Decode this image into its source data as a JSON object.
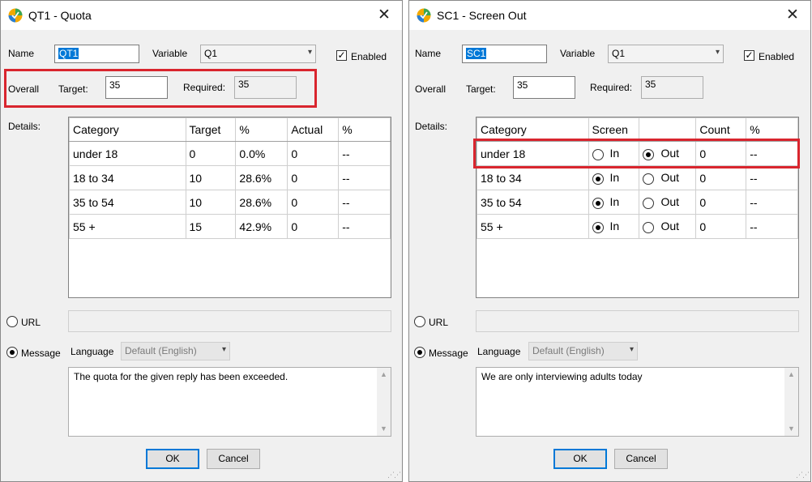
{
  "quota_dialog": {
    "title": "QT1 - Quota",
    "name_label": "Name",
    "name_value": "QT1",
    "variable_label": "Variable",
    "variable_value": "Q1",
    "enabled_label": "Enabled",
    "enabled": true,
    "overall_label": "Overall",
    "target_label": "Target:",
    "target_value": "35",
    "required_label": "Required:",
    "required_value": "35",
    "details_label": "Details:",
    "columns": [
      "Category",
      "Target",
      "%",
      "Actual",
      "%"
    ],
    "rows": [
      {
        "category": "under 18",
        "target": "0",
        "pct": "0.0%",
        "actual": "0",
        "pct2": "--"
      },
      {
        "category": "18 to 34",
        "target": "10",
        "pct": "28.6%",
        "actual": "0",
        "pct2": "--"
      },
      {
        "category": "35 to 54",
        "target": "10",
        "pct": "28.6%",
        "actual": "0",
        "pct2": "--"
      },
      {
        "category": "55 +",
        "target": "15",
        "pct": "42.9%",
        "actual": "0",
        "pct2": "--"
      }
    ],
    "url_label": "URL",
    "message_label": "Message",
    "language_label": "Language",
    "language_value": "Default (English)",
    "message_text": "The quota for the given reply has been exceeded.",
    "ok_label": "OK",
    "cancel_label": "Cancel"
  },
  "screen_dialog": {
    "title": "SC1 - Screen Out",
    "name_label": "Name",
    "name_value": "SC1",
    "variable_label": "Variable",
    "variable_value": "Q1",
    "enabled_label": "Enabled",
    "enabled": true,
    "overall_label": "Overall",
    "target_label": "Target:",
    "target_value": "35",
    "required_label": "Required:",
    "required_value": "35",
    "details_label": "Details:",
    "columns": [
      "Category",
      "Screen",
      "",
      "Count",
      "%"
    ],
    "in_label": "In",
    "out_label": "Out",
    "rows": [
      {
        "category": "under 18",
        "screen": "out",
        "count": "0",
        "pct": "--"
      },
      {
        "category": "18 to 34",
        "screen": "in",
        "count": "0",
        "pct": "--"
      },
      {
        "category": "35 to 54",
        "screen": "in",
        "count": "0",
        "pct": "--"
      },
      {
        "category": "55 +",
        "screen": "in",
        "count": "0",
        "pct": "--"
      }
    ],
    "url_label": "URL",
    "message_label": "Message",
    "language_label": "Language",
    "language_value": "Default (English)",
    "message_text": "We are only interviewing adults today",
    "ok_label": "OK",
    "cancel_label": "Cancel"
  },
  "colors": {
    "highlight": "#d9252e",
    "selection": "#0078d7",
    "dialog_bg": "#f0f0f0"
  },
  "icons": {
    "app": "app-logo-icon",
    "close": "close-icon",
    "dropdown": "chevron-down-icon",
    "checkbox": "checkmark-icon"
  }
}
